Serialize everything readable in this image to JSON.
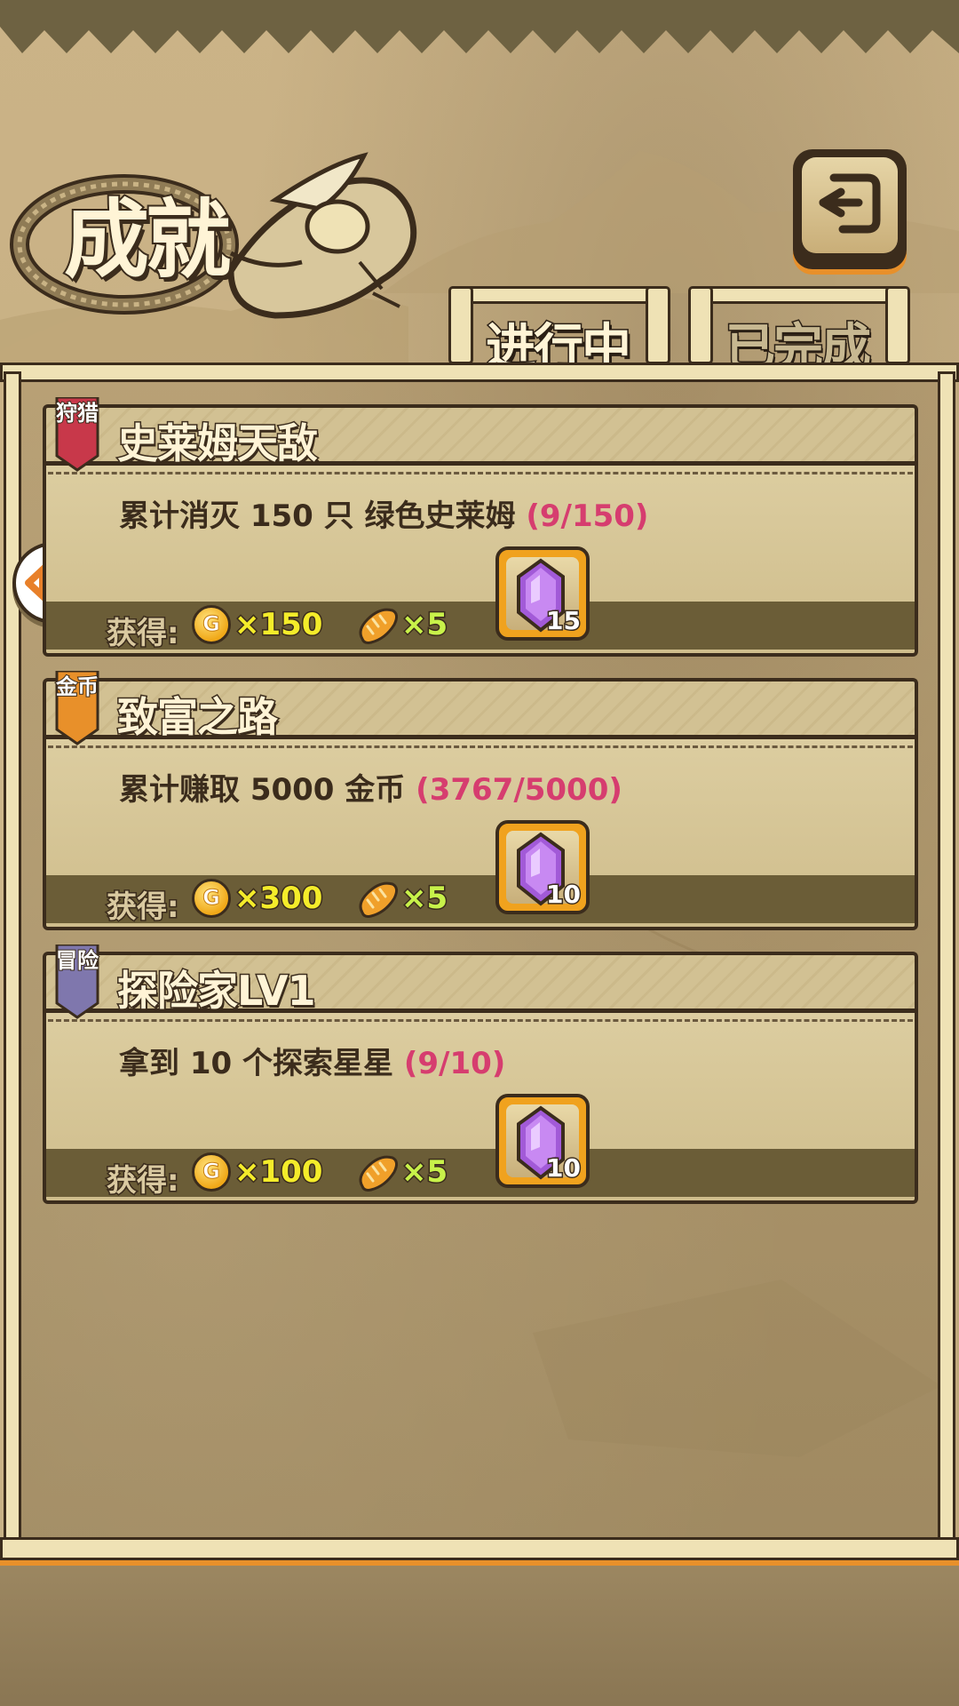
{
  "header": {
    "title": "成就",
    "back_icon": "back-arrow-icon"
  },
  "tabs": [
    {
      "label": "进行中",
      "active": true
    },
    {
      "label": "已完成",
      "active": false
    }
  ],
  "reward_prefix": "获得:",
  "achievements": [
    {
      "category": "狩猎",
      "category_color": "#c8384a",
      "title": "史莱姆天敌",
      "description": "累计消灭 150 只 绿色史莱姆",
      "progress": "(9/150)",
      "coins": "×150",
      "bread": "×5",
      "gem_count": "15"
    },
    {
      "category": "金币",
      "category_color": "#e8902a",
      "title": "致富之路",
      "description": "累计赚取 5000 金币",
      "progress": "(3767/5000)",
      "coins": "×300",
      "bread": "×5",
      "gem_count": "10"
    },
    {
      "category": "冒险",
      "category_color": "#7f77ad",
      "title": "探险家LV1",
      "description": "拿到 10 个探索星星",
      "progress": "(9/10)",
      "coins": "×100",
      "bread": "×5",
      "gem_count": "10"
    }
  ],
  "coin_glyph": "G",
  "colors": {
    "progress": "#d63d6f",
    "coin_amount": "#f4ec2a",
    "bread_amount": "#c8f24a",
    "accent_orange": "#e8902a",
    "outline": "#3b2c1c"
  }
}
